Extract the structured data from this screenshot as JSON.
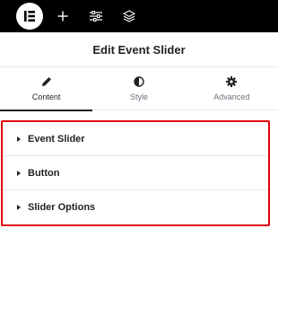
{
  "topbar": {
    "icons": [
      "elementor-logo-icon",
      "plus-icon",
      "sliders-icon",
      "layers-icon"
    ]
  },
  "header": {
    "title": "Edit Event Slider"
  },
  "tabs": [
    {
      "label": "Content",
      "icon": "pencil-icon",
      "active": true
    },
    {
      "label": "Style",
      "icon": "half-circle-icon",
      "active": false
    },
    {
      "label": "Advanced",
      "icon": "gear-icon",
      "active": false
    }
  ],
  "sections": [
    {
      "label": "Event Slider"
    },
    {
      "label": "Button"
    },
    {
      "label": "Slider Options"
    }
  ],
  "colors": {
    "topbar_bg": "#000000",
    "highlight_border": "#e0000f",
    "text_primary": "#1f2124",
    "text_muted": "#69727d"
  }
}
